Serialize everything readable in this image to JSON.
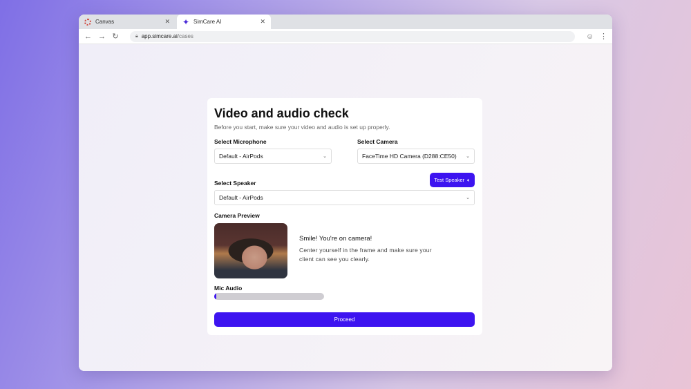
{
  "browser": {
    "tabs": [
      {
        "label": "Canvas",
        "icon": "canvas-logo-icon"
      },
      {
        "label": "SimCare AI",
        "icon": "simcare-logo-icon",
        "active": true
      }
    ],
    "url_host": "app.simcare.ai",
    "url_path": "/cases"
  },
  "page": {
    "title": "Video and audio check",
    "subtitle": "Before you start, make sure your video and audio is set up properly.",
    "microphone": {
      "label": "Select Microphone",
      "value": "Default - AirPods"
    },
    "camera": {
      "label": "Select Camera",
      "value": "FaceTime HD Camera (D288:CE50)"
    },
    "speaker": {
      "label": "Select Speaker",
      "value": "Default - AirPods",
      "test_button": "Test Speaker"
    },
    "preview": {
      "label": "Camera Preview",
      "headline": "Smile! You're on camera!",
      "hint": "Center yourself in the frame and make sure your client can see you clearly."
    },
    "mic": {
      "label": "Mic Audio",
      "level_percent": 2
    },
    "proceed": "Proceed",
    "accent": "#3d14f0"
  }
}
